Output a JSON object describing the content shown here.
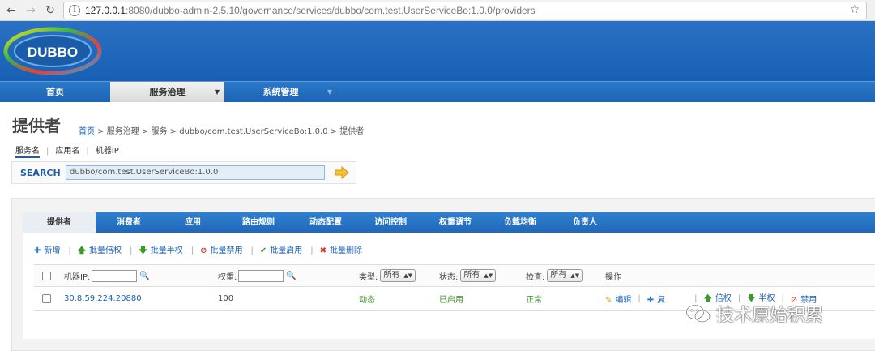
{
  "browser": {
    "url_host": "127.0.0.1",
    "url_rest": ":8080/dubbo-admin-2.5.10/governance/services/dubbo/com.test.UserServiceBo:1.0.0/providers",
    "back_icon": "arrow-left-icon",
    "forward_icon": "arrow-right-icon",
    "reload_icon": "reload-icon",
    "info_icon": "info-icon",
    "star_icon": "bookmark-star-icon"
  },
  "logo": {
    "text": "DUBBO"
  },
  "menu": [
    {
      "label": "首页"
    },
    {
      "label": "服务治理",
      "active": true
    },
    {
      "label": "系统管理"
    }
  ],
  "page": {
    "title": "提供者",
    "breadcrumb_home": "首页",
    "breadcrumb_rest": " > 服务治理 > 服务 > dubbo/com.test.UserServiceBo:1.0.0 > 提供者"
  },
  "search_tabs": [
    "服务名",
    "应用名",
    "机器IP"
  ],
  "search": {
    "label": "SEARCH",
    "value": "dubbo/com.test.UserServiceBo:1.0.0"
  },
  "tabs": [
    "提供者",
    "消费者",
    "应用",
    "路由规则",
    "动态配置",
    "访问控制",
    "权重调节",
    "负载均衡",
    "负责人"
  ],
  "actions": [
    {
      "icon": "plus-icon",
      "label": "新增"
    },
    {
      "icon": "up-arrow-icon",
      "label": "批量倍权"
    },
    {
      "icon": "down-arrow-icon",
      "label": "批量半权"
    },
    {
      "icon": "forbid-icon",
      "label": "批量禁用"
    },
    {
      "icon": "check-icon",
      "label": "批量启用"
    },
    {
      "icon": "cross-icon",
      "label": "批量删除"
    }
  ],
  "table": {
    "headers": {
      "ip": "机器IP:",
      "weight": "权重:",
      "type": "类型:",
      "type_value": "所有",
      "status": "状态:",
      "status_value": "所有",
      "check": "检查:",
      "check_value": "所有",
      "ops": "操作"
    },
    "rows": [
      {
        "ip": "30.8.59.224:20880",
        "weight": "100",
        "type": "动态",
        "status": "已启用",
        "check": "正常",
        "ops": [
          "编辑",
          "复",
          "倍权",
          "半权",
          "禁用"
        ]
      }
    ]
  },
  "watermark": {
    "text": "技术原始积累",
    "icon": "wechat-icon"
  },
  "colors": {
    "header_blue": "#1860b4",
    "link_blue": "#1a5fb4",
    "ok_green": "#3a8f2a"
  }
}
